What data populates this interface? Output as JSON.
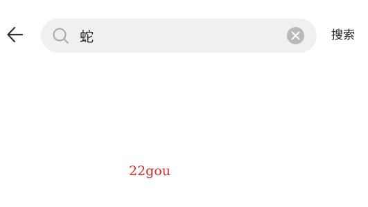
{
  "header": {
    "back_icon": "arrow-left-icon",
    "search": {
      "icon": "search-icon",
      "value": "蛇",
      "placeholder": "",
      "clear_icon": "close-circle-icon"
    },
    "submit_label": "搜索"
  },
  "watermark": {
    "text": "22gou"
  },
  "colors": {
    "search_bg": "#f0f0f0",
    "clear_bg": "#b9b9b9",
    "watermark": "#d82a2a",
    "text": "#222222"
  }
}
